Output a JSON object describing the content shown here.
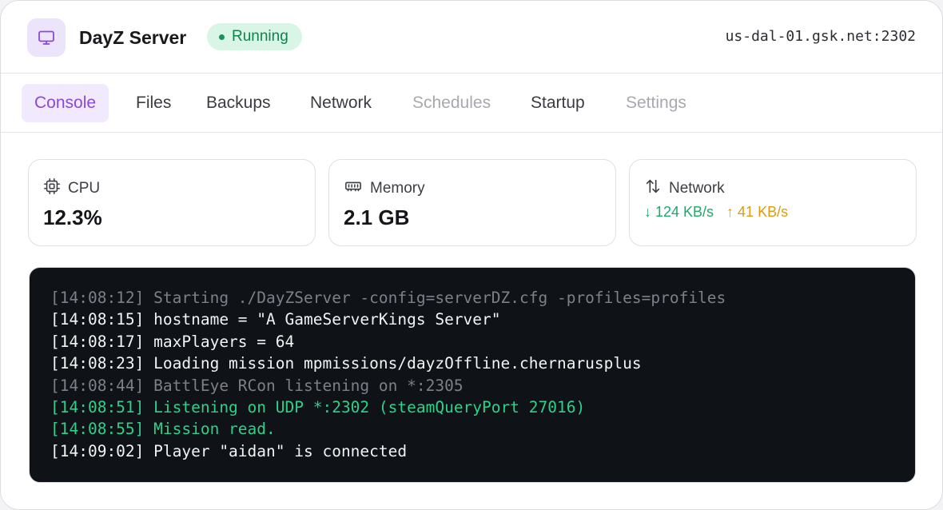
{
  "header": {
    "app_title": "DayZ Server",
    "status": "Running",
    "host": "us-dal-01.gsk.net:2302",
    "app_icon": "monitor-icon"
  },
  "tabs": [
    {
      "label": "Console",
      "state": "active"
    },
    {
      "label": "Files",
      "state": "normal"
    },
    {
      "label": "Backups",
      "state": "normal"
    },
    {
      "label": "Network",
      "state": "normal"
    },
    {
      "label": "Schedules",
      "state": "disabled"
    },
    {
      "label": "Startup",
      "state": "normal"
    },
    {
      "label": "Settings",
      "state": "disabled"
    }
  ],
  "stats": {
    "cpu": {
      "label": "CPU",
      "value": "12.3%",
      "icon": "cpu-icon"
    },
    "memory": {
      "label": "Memory",
      "value": "2.1 GB",
      "icon": "memory-icon"
    },
    "network": {
      "label": "Network",
      "down": "↓ 124 KB/s",
      "up": "↑ 41 KB/s",
      "icon": "transfer-icon"
    }
  },
  "console": {
    "lines": [
      {
        "text": "[14:08:12] Starting ./DayZServer -config=serverDZ.cfg -profiles=profiles",
        "level": "muted"
      },
      {
        "text": "[14:08:15] hostname = \"A GameServerKings Server\"",
        "level": "info"
      },
      {
        "text": "[14:08:17] maxPlayers = 64",
        "level": "info"
      },
      {
        "text": "[14:08:23] Loading mission mpmissions/dayzOffline.chernarusplus",
        "level": "info"
      },
      {
        "text": "[14:08:44] BattlEye RCon listening on *:2305",
        "level": "muted"
      },
      {
        "text": "[14:08:51] Listening on UDP *:2302 (steamQueryPort 27016)",
        "level": "success"
      },
      {
        "text": "[14:08:55] Mission read.",
        "level": "success"
      },
      {
        "text": "[14:09:02] Player \"aidan\" is connected",
        "level": "info"
      }
    ]
  },
  "colors": {
    "accent": "#8a49d6",
    "status_green": "#13804e",
    "console_bg": "#0f1217",
    "download": "#1ea86a",
    "upload": "#e09a10"
  }
}
